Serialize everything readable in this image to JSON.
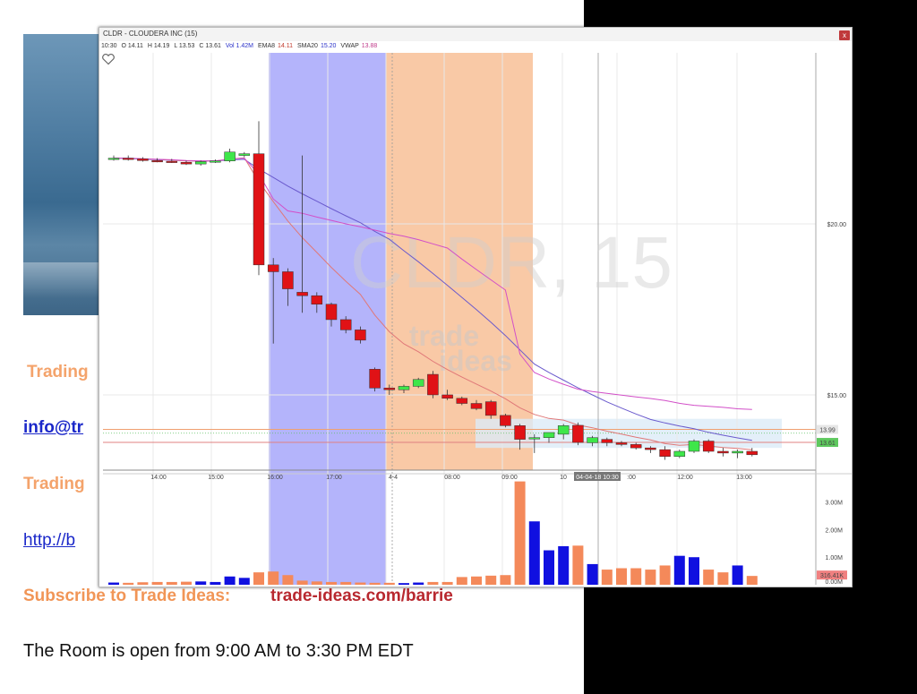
{
  "slide": {
    "trading_1": "Trading",
    "email": "info@tr",
    "trading_2": "Trading",
    "link": "http://b",
    "subscribe_label": "Subscribe to Trade Ideas:",
    "subscribe_url": "trade-ideas.com/barrie",
    "room": "The Room is open from 9:00 AM to 3:30 PM EDT"
  },
  "window": {
    "title": "CLDR - CLOUDERA INC (15)",
    "close_label": "x",
    "info": {
      "time": "10:30",
      "open": "O 14.11",
      "high": "H 14.19",
      "low": "L 13.53",
      "close": "C 13.61",
      "vol": "Vol 1.42M",
      "ema_label": "EMA8",
      "ema_value": "14.11",
      "sma_label": "SMA20",
      "sma_value": "15.20",
      "vwap_label": "VWAP",
      "vwap_value": "13.88"
    },
    "watermark_symbol": "CLDR, 15",
    "watermark_brand_1": "trade",
    "watermark_brand_2": "ideas"
  },
  "colors": {
    "up": "#3ee64a",
    "down": "#e01216",
    "vol_up": "#1010e0",
    "vol_down": "#f4895a",
    "premarket_shade": "#b4b4fb",
    "afterhours_shade": "#f9c9a6",
    "ema": "#e07878",
    "sma": "#6a5acd",
    "vwap": "#d24fc8"
  },
  "chart_data": {
    "type": "candlestick",
    "price_axis": {
      "ticks": [
        {
          "value": 20,
          "label": "$20.00"
        },
        {
          "value": 15,
          "label": "$15.00"
        }
      ],
      "highlighted": [
        {
          "value": 13.99,
          "label": "13.99"
        },
        {
          "value": 13.61,
          "label": "13.61"
        }
      ],
      "range": [
        12.8,
        25
      ]
    },
    "time_ticks": [
      "14:00",
      "15:00",
      "16:00",
      "17:00",
      "4-4",
      "08:00",
      "09:00",
      "10",
      "04-04-18 10:30",
      ":00",
      "12:00",
      "13:00"
    ],
    "volume_axis": {
      "ticks": [
        "3.00M",
        "2.00M",
        "1.00M"
      ],
      "current_label": "316.41K",
      "zero_label": "0.00M",
      "range": [
        0,
        3.9
      ]
    },
    "candles": [
      {
        "o": 21.9,
        "h": 22.0,
        "l": 21.85,
        "c": 21.92,
        "v": 0.08
      },
      {
        "o": 21.92,
        "h": 22.0,
        "l": 21.85,
        "c": 21.9,
        "v": 0.07
      },
      {
        "o": 21.9,
        "h": 21.95,
        "l": 21.82,
        "c": 21.85,
        "v": 0.09
      },
      {
        "o": 21.85,
        "h": 21.92,
        "l": 21.8,
        "c": 21.83,
        "v": 0.1
      },
      {
        "o": 21.83,
        "h": 21.9,
        "l": 21.78,
        "c": 21.8,
        "v": 0.1
      },
      {
        "o": 21.8,
        "h": 21.85,
        "l": 21.72,
        "c": 21.75,
        "v": 0.11
      },
      {
        "o": 21.75,
        "h": 21.85,
        "l": 21.7,
        "c": 21.82,
        "v": 0.12
      },
      {
        "o": 21.82,
        "h": 21.88,
        "l": 21.78,
        "c": 21.84,
        "v": 0.1
      },
      {
        "o": 21.84,
        "h": 22.2,
        "l": 21.8,
        "c": 22.1,
        "v": 0.3
      },
      {
        "o": 22.0,
        "h": 22.1,
        "l": 21.95,
        "c": 22.05,
        "v": 0.25
      },
      {
        "o": 22.05,
        "h": 23.0,
        "l": 18.5,
        "c": 18.8,
        "v": 0.45
      },
      {
        "o": 18.8,
        "h": 19.0,
        "l": 16.5,
        "c": 18.6,
        "v": 0.48
      },
      {
        "o": 18.6,
        "h": 18.7,
        "l": 17.6,
        "c": 18.1,
        "v": 0.35
      },
      {
        "o": 18.0,
        "h": 22.0,
        "l": 17.4,
        "c": 17.9,
        "v": 0.15
      },
      {
        "o": 17.9,
        "h": 18.0,
        "l": 17.4,
        "c": 17.65,
        "v": 0.12
      },
      {
        "o": 17.65,
        "h": 17.7,
        "l": 17.0,
        "c": 17.2,
        "v": 0.1
      },
      {
        "o": 17.2,
        "h": 17.3,
        "l": 16.8,
        "c": 16.9,
        "v": 0.1
      },
      {
        "o": 16.9,
        "h": 17.0,
        "l": 16.5,
        "c": 16.6,
        "v": 0.08
      },
      {
        "o": 15.75,
        "h": 15.8,
        "l": 15.1,
        "c": 15.2,
        "v": 0.07
      },
      {
        "o": 15.2,
        "h": 15.3,
        "l": 15.0,
        "c": 15.15,
        "v": 0.07
      },
      {
        "o": 15.15,
        "h": 15.3,
        "l": 15.05,
        "c": 15.25,
        "v": 0.06
      },
      {
        "o": 15.25,
        "h": 15.5,
        "l": 15.2,
        "c": 15.45,
        "v": 0.08
      },
      {
        "o": 15.6,
        "h": 15.7,
        "l": 14.9,
        "c": 15.0,
        "v": 0.1
      },
      {
        "o": 15.0,
        "h": 15.15,
        "l": 14.85,
        "c": 14.9,
        "v": 0.1
      },
      {
        "o": 14.9,
        "h": 14.95,
        "l": 14.7,
        "c": 14.75,
        "v": 0.28
      },
      {
        "o": 14.75,
        "h": 14.85,
        "l": 14.55,
        "c": 14.6,
        "v": 0.3
      },
      {
        "o": 14.8,
        "h": 14.85,
        "l": 14.3,
        "c": 14.4,
        "v": 0.33
      },
      {
        "o": 14.4,
        "h": 14.45,
        "l": 14.05,
        "c": 14.1,
        "v": 0.35
      },
      {
        "o": 14.1,
        "h": 14.15,
        "l": 13.4,
        "c": 13.7,
        "v": 3.75
      },
      {
        "o": 13.72,
        "h": 13.85,
        "l": 13.3,
        "c": 13.75,
        "v": 2.3
      },
      {
        "o": 13.75,
        "h": 13.9,
        "l": 13.6,
        "c": 13.9,
        "v": 1.25
      },
      {
        "o": 13.85,
        "h": 14.15,
        "l": 13.7,
        "c": 14.1,
        "v": 1.4
      },
      {
        "o": 14.11,
        "h": 14.19,
        "l": 13.53,
        "c": 13.61,
        "v": 1.42
      },
      {
        "o": 13.6,
        "h": 13.8,
        "l": 13.5,
        "c": 13.75,
        "v": 0.75
      },
      {
        "o": 13.7,
        "h": 13.75,
        "l": 13.5,
        "c": 13.6,
        "v": 0.55
      },
      {
        "o": 13.6,
        "h": 13.65,
        "l": 13.5,
        "c": 13.55,
        "v": 0.6
      },
      {
        "o": 13.55,
        "h": 13.6,
        "l": 13.4,
        "c": 13.45,
        "v": 0.6
      },
      {
        "o": 13.45,
        "h": 13.5,
        "l": 13.3,
        "c": 13.4,
        "v": 0.55
      },
      {
        "o": 13.4,
        "h": 13.5,
        "l": 13.1,
        "c": 13.2,
        "v": 0.7
      },
      {
        "o": 13.2,
        "h": 13.4,
        "l": 13.15,
        "c": 13.35,
        "v": 1.05
      },
      {
        "o": 13.35,
        "h": 13.7,
        "l": 13.3,
        "c": 13.65,
        "v": 1.0
      },
      {
        "o": 13.65,
        "h": 13.7,
        "l": 13.3,
        "c": 13.35,
        "v": 0.55
      },
      {
        "o": 13.35,
        "h": 13.45,
        "l": 13.2,
        "c": 13.3,
        "v": 0.45
      },
      {
        "o": 13.3,
        "h": 13.4,
        "l": 13.15,
        "c": 13.35,
        "v": 0.7
      },
      {
        "o": 13.35,
        "h": 13.45,
        "l": 13.2,
        "c": 13.25,
        "v": 0.32
      }
    ]
  }
}
